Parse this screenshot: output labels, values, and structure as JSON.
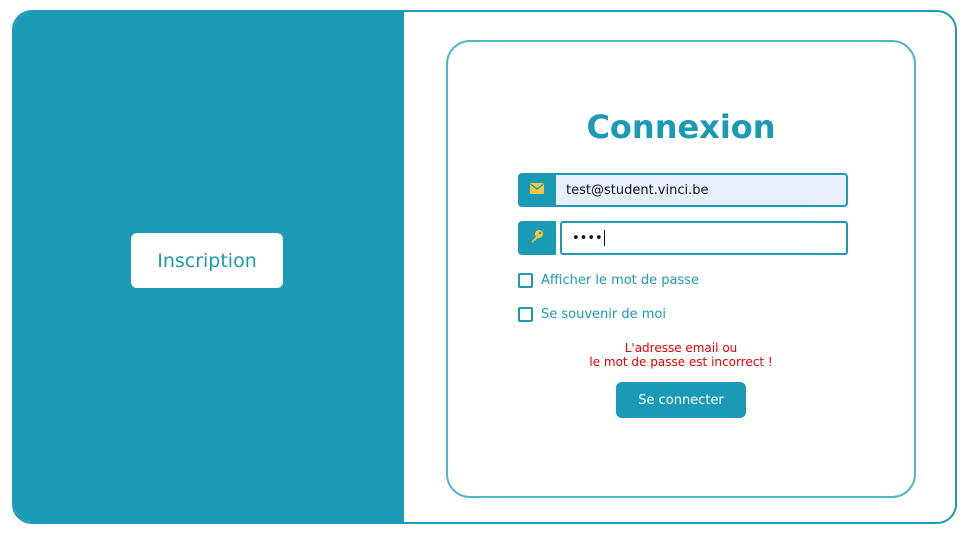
{
  "left_panel": {
    "inscription_label": "Inscription"
  },
  "login": {
    "title": "Connexion",
    "email": {
      "value": "test@student.vinci.be",
      "icon": "envelope-icon"
    },
    "password": {
      "value": "••••",
      "icon": "key-icon"
    },
    "show_password_label": "Afficher le mot de passe",
    "remember_me_label": "Se souvenir de moi",
    "error_line1": "L'adresse email ou",
    "error_line2": "le mot de passe est incorrect !",
    "submit_label": "Se connecter"
  },
  "colors": {
    "primary": "#1a9ab5",
    "error": "#e60000",
    "icon_accent": "#f5c842"
  }
}
